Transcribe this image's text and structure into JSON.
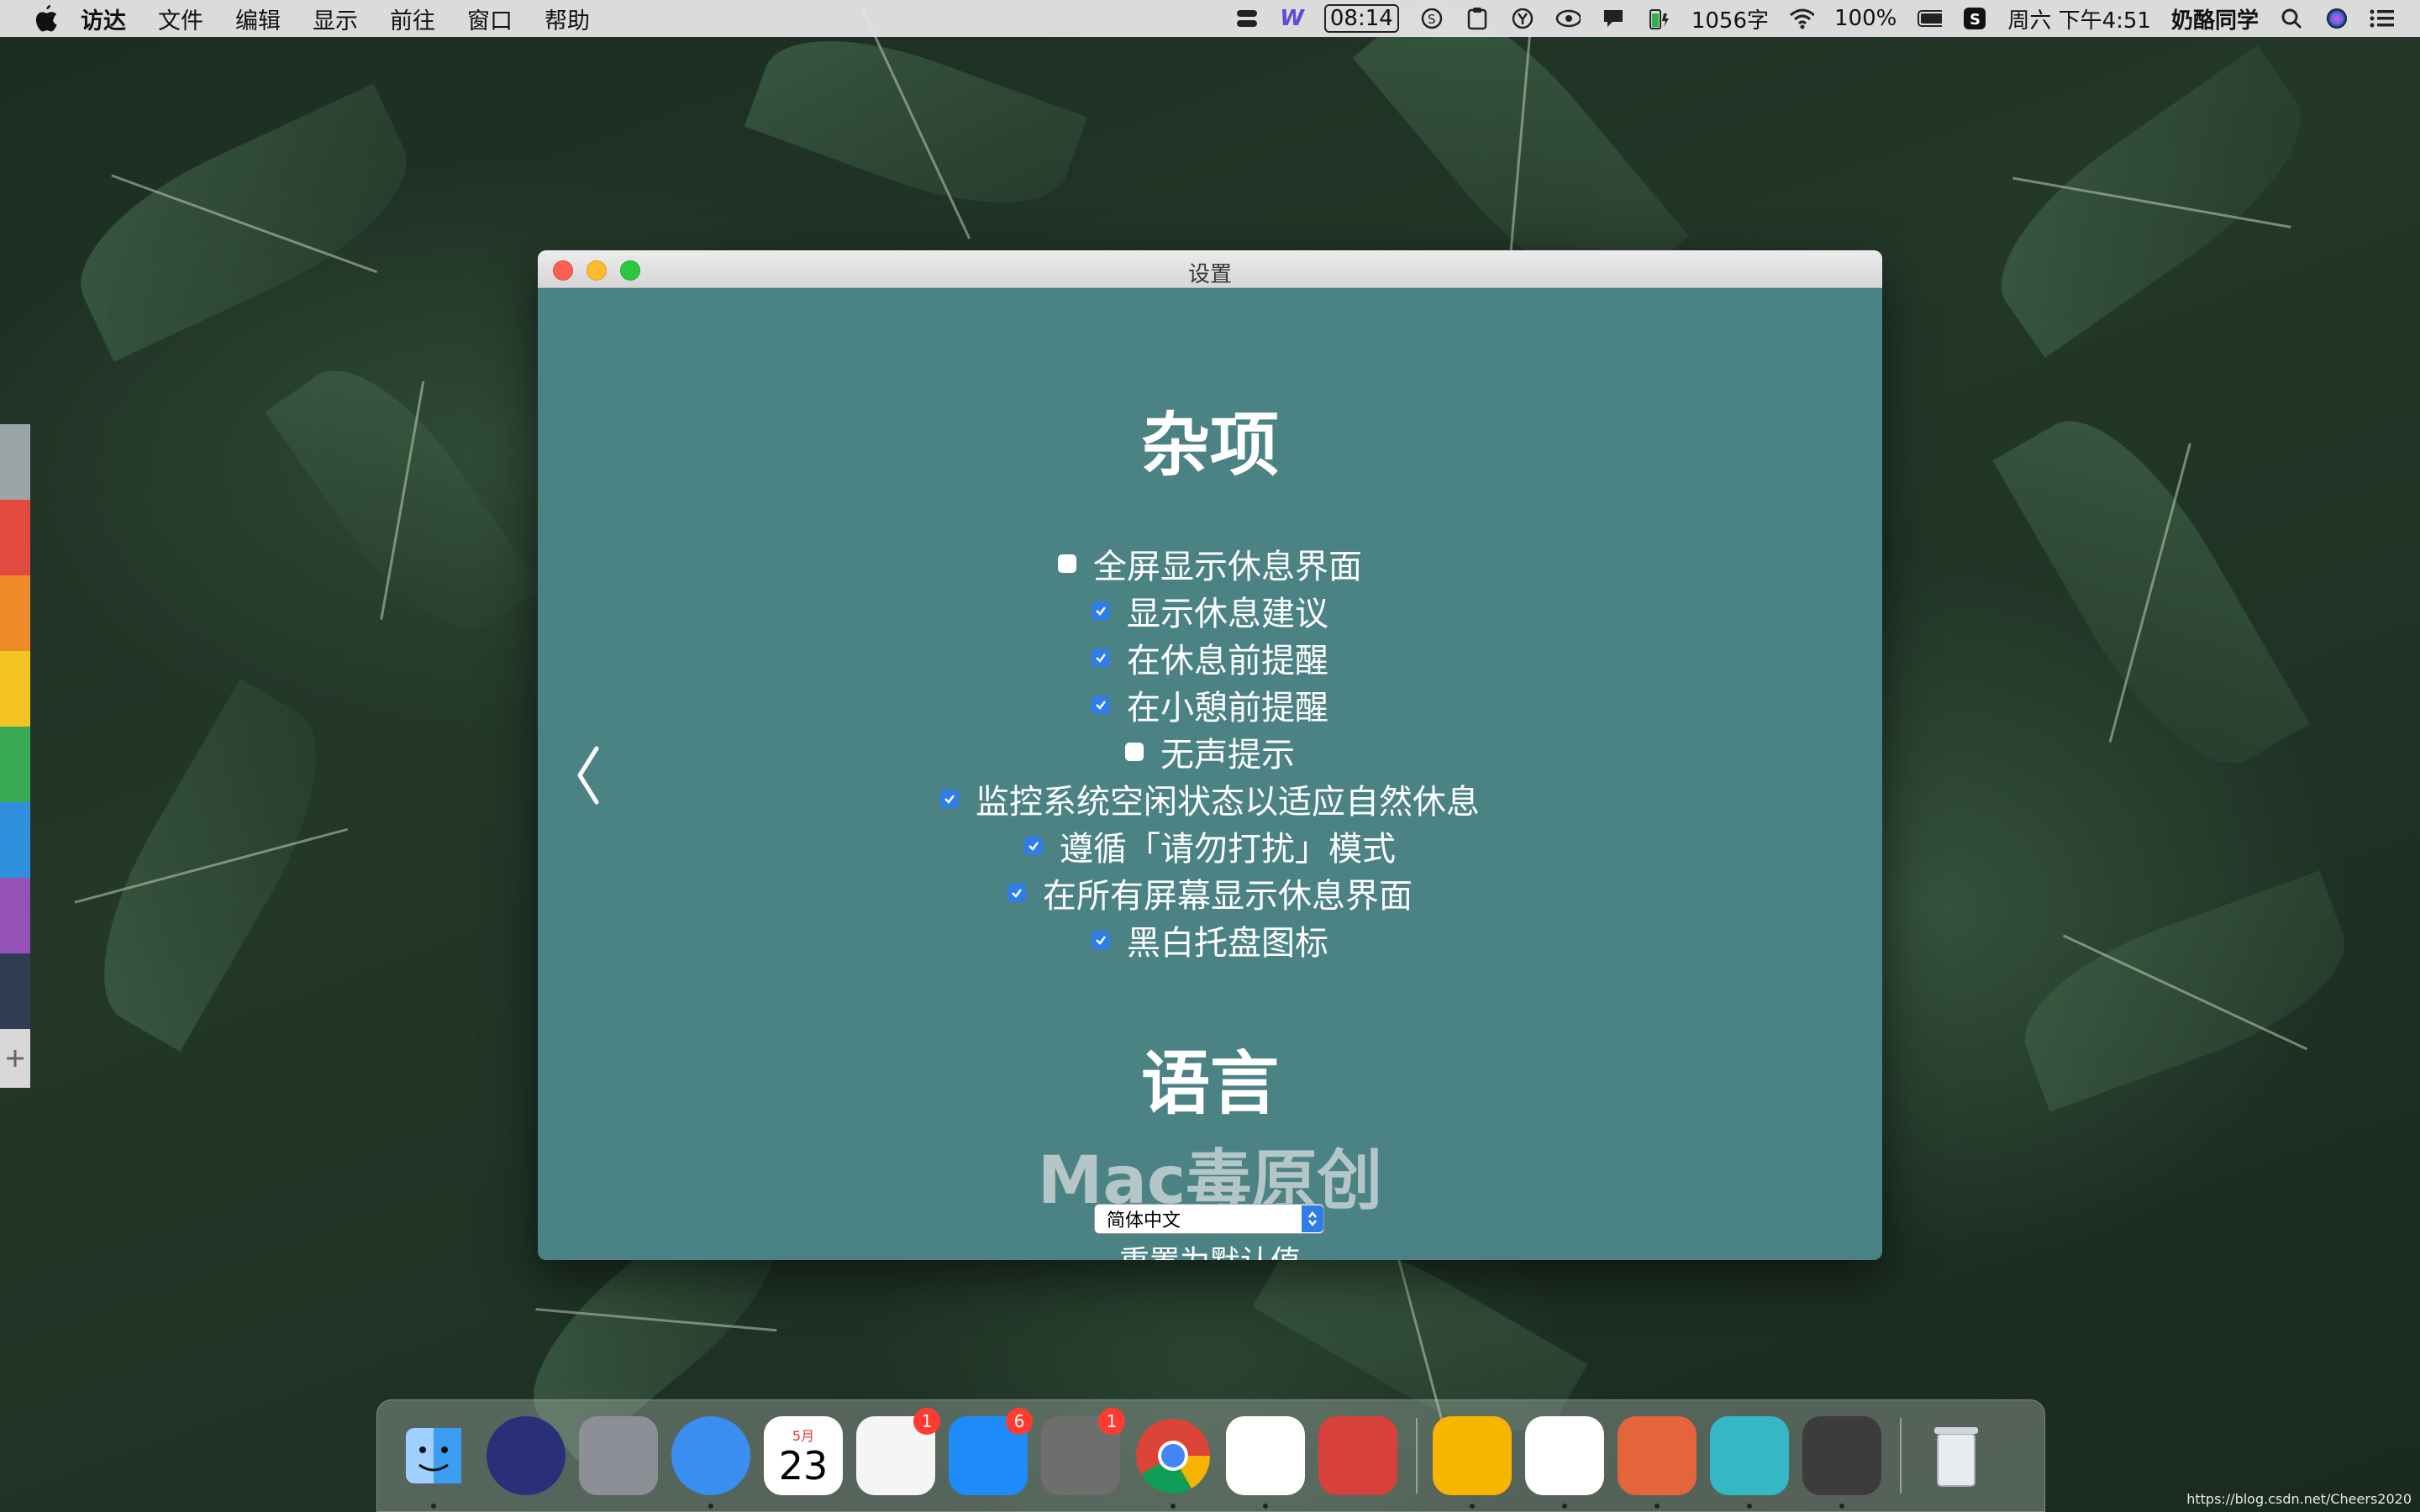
{
  "menubar": {
    "app_name": "访达",
    "items": [
      "文件",
      "编辑",
      "显示",
      "前往",
      "窗口",
      "帮助"
    ],
    "status": {
      "timer": "08:14",
      "word_count": "1056字",
      "battery": "100%",
      "datetime": "周六 下午4:51",
      "user": "奶酪同学"
    }
  },
  "window": {
    "title": "设置",
    "misc_title": "杂项",
    "options": [
      {
        "label": "全屏显示休息界面",
        "checked": false
      },
      {
        "label": "显示休息建议",
        "checked": true
      },
      {
        "label": "在休息前提醒",
        "checked": true
      },
      {
        "label": "在小憩前提醒",
        "checked": true
      },
      {
        "label": "无声提示",
        "checked": false
      },
      {
        "label": "监控系统空闲状态以适应自然休息",
        "checked": true
      },
      {
        "label": "遵循「请勿打扰」模式",
        "checked": true
      },
      {
        "label": "在所有屏幕显示休息界面",
        "checked": true
      },
      {
        "label": "黑白托盘图标",
        "checked": true
      }
    ],
    "language_title": "语言",
    "watermark": "Mac毒原创",
    "language_value": "简体中文",
    "reset_label": "重置为默认值"
  },
  "dock": {
    "apps": [
      {
        "name": "finder",
        "color": "#3d9df3",
        "running": true
      },
      {
        "name": "siri",
        "color": "#2a2f7a",
        "running": false
      },
      {
        "name": "launchpad",
        "color": "#8c9096",
        "running": false
      },
      {
        "name": "safari",
        "color": "#3a8ef0",
        "running": true
      },
      {
        "name": "calendar",
        "color": "#ffffff",
        "running": false,
        "month": "5月",
        "day": "23"
      },
      {
        "name": "photos",
        "color": "#f5f5f5",
        "running": false,
        "badge": "1"
      },
      {
        "name": "app-store",
        "color": "#1d8cf8",
        "running": false,
        "badge": "6"
      },
      {
        "name": "system-preferences",
        "color": "#6e6e6e",
        "running": false,
        "badge": "1"
      },
      {
        "name": "chrome",
        "color": "#ffffff",
        "running": true
      },
      {
        "name": "paper-plane",
        "color": "#ffffff",
        "running": true
      },
      {
        "name": "bear",
        "color": "#d8413b",
        "running": false
      },
      {
        "name": "sketch",
        "color": "#f7b500",
        "running": true
      },
      {
        "name": "baidu-netdisk",
        "color": "#ffffff",
        "running": true
      },
      {
        "name": "deer-app",
        "color": "#e4643c",
        "running": true
      },
      {
        "name": "scissors-app",
        "color": "#35b8c4",
        "running": true
      },
      {
        "name": "video-app",
        "color": "#3c3c3c",
        "running": true
      },
      {
        "name": "trash",
        "color": "#c8ccd0",
        "running": false
      }
    ]
  },
  "side_strip_colors": [
    "#9aa5a6",
    "#e24a40",
    "#ef8a2a",
    "#f3c523",
    "#39a956",
    "#2f8fdc",
    "#9651b8",
    "#2e3d52",
    "#d8d8d8"
  ],
  "credit": "https://blog.csdn.net/Cheers2020"
}
